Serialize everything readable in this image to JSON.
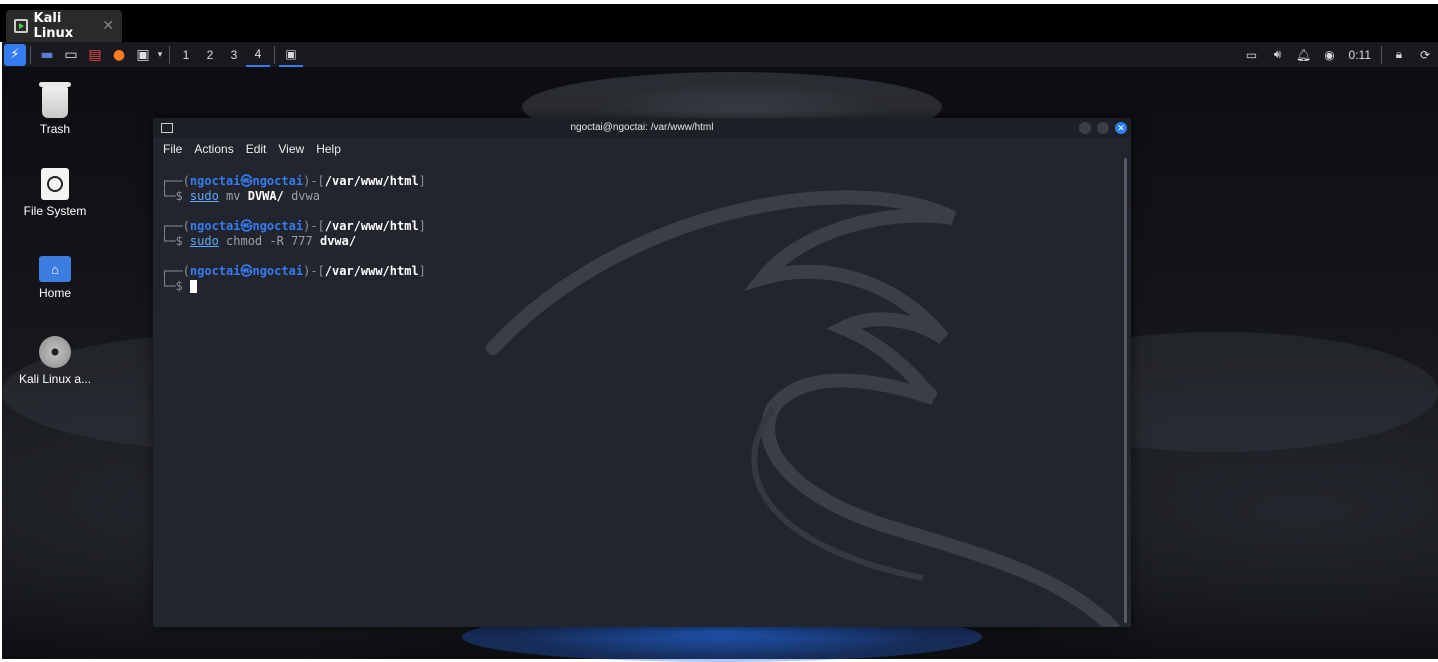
{
  "host": {
    "tab_title": "Kali Linux",
    "tab_close": "✕"
  },
  "panel": {
    "workspaces": [
      "1",
      "2",
      "3",
      "4"
    ],
    "active_workspace": "4",
    "clock": "0:11"
  },
  "desktop_icons": [
    {
      "label": "Trash"
    },
    {
      "label": "File System"
    },
    {
      "label": "Home"
    },
    {
      "label": "Kali Linux a..."
    }
  ],
  "terminal": {
    "title": "ngoctai@ngoctai: /var/www/html",
    "menu": [
      "File",
      "Actions",
      "Edit",
      "View",
      "Help"
    ],
    "prompt": {
      "top": "┌──(",
      "user": "ngoctai㉿ngoctai",
      "mid": ")-[",
      "path": "/var/www/html",
      "end": "]",
      "bottom": "└─$ "
    },
    "commands": [
      {
        "cmd": "sudo",
        "args": [
          {
            "text": " mv ",
            "bold": false
          },
          {
            "text": "DVWA/",
            "bold": true
          },
          {
            "text": " dvwa",
            "bold": false
          }
        ]
      },
      {
        "cmd": "sudo",
        "args": [
          {
            "text": " chmod -R ",
            "bold": false
          },
          {
            "text": "777",
            "bold": false
          },
          {
            "text": " dvwa/",
            "bold": true
          }
        ]
      }
    ]
  }
}
